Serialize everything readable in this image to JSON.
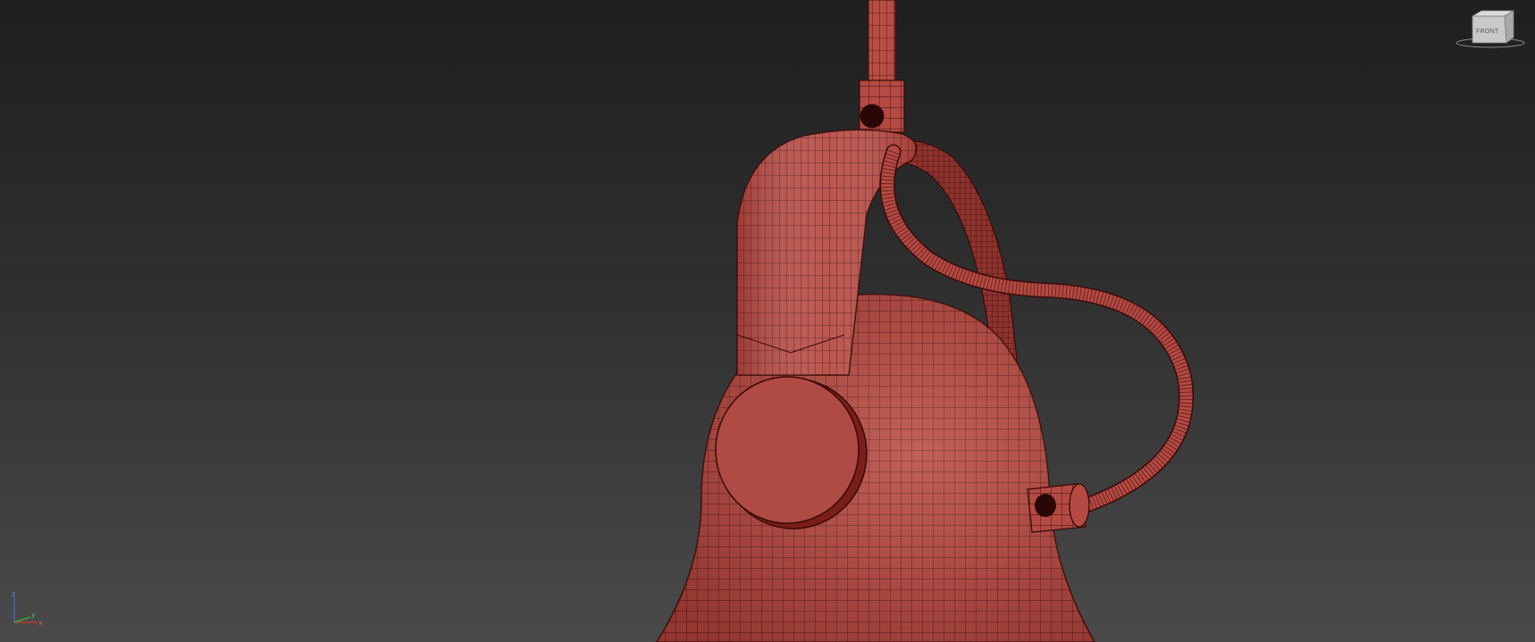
{
  "viewport": {
    "view_name": "Front",
    "shading_color": "#b84a42",
    "wire_color": "#3a0a08",
    "background_top": "#1f1f1f",
    "background_bottom": "#4a4a4a"
  },
  "viewcube": {
    "face_label": "FRONT",
    "icon": "viewcube-icon"
  },
  "axis_gizmo": {
    "icon": "axis-tripod-icon",
    "z_label": "z",
    "x_label": "x",
    "y_label": "y",
    "colors": {
      "x": "#d23a2a",
      "y": "#3ab23a",
      "z": "#4a6ad8"
    }
  },
  "model": {
    "name": "hanging-lamp-bell-mesh"
  }
}
